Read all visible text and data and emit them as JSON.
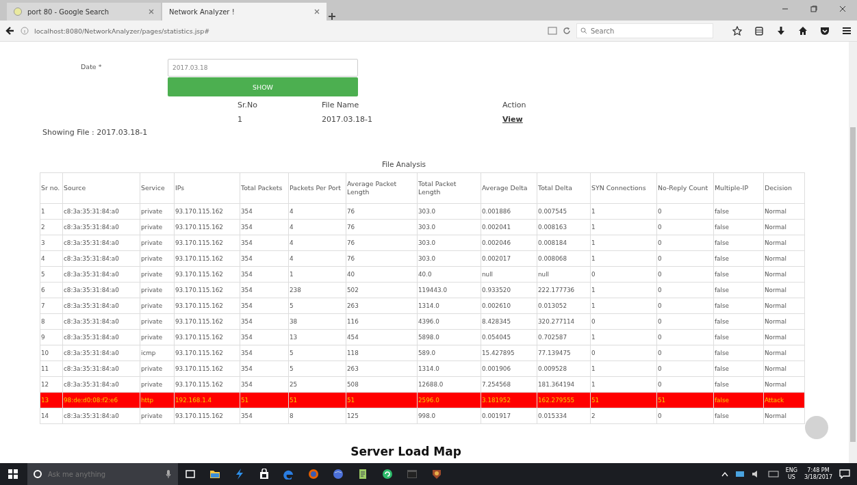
{
  "browser": {
    "tabs": [
      {
        "label": "port 80 - Google Search",
        "selected": false
      },
      {
        "label": "Network Analyzer !",
        "selected": true
      }
    ],
    "address": "localhost:8080/NetworkAnalyzer/pages/statistics.jsp#",
    "search": {
      "placeholder": "Search"
    }
  },
  "form": {
    "date_label": "Date *",
    "date_value": "2017.03.18",
    "button": "SHOW"
  },
  "files": {
    "columns": [
      "Sr.No",
      "File Name",
      "Action"
    ],
    "rows": [
      {
        "sr": "1",
        "name": "2017.03.18-1",
        "action": "View"
      }
    ]
  },
  "showing": "Showing File : 2017.03.18-1",
  "analysis": {
    "title": "File Analysis",
    "columns": [
      "Sr no.",
      "Source",
      "Service",
      "IPs",
      "Total Packets",
      "Packets Per Port",
      "Average Packet Length",
      "Total Packet Length",
      "Average Delta",
      "Total Delta",
      "SYN Connections",
      "No-Reply Count",
      "Multiple-IP",
      "Decision"
    ],
    "rows": [
      {
        "highlighted": false,
        "cells": [
          "1",
          "c8:3a:35:31:84:a0",
          "private",
          "93.170.115.162",
          "354",
          "4",
          "76",
          "303.0",
          "0.001886",
          "0.007545",
          "1",
          "0",
          "false",
          "Normal"
        ]
      },
      {
        "highlighted": false,
        "cells": [
          "2",
          "c8:3a:35:31:84:a0",
          "private",
          "93.170.115.162",
          "354",
          "4",
          "76",
          "303.0",
          "0.002041",
          "0.008163",
          "1",
          "0",
          "false",
          "Normal"
        ]
      },
      {
        "highlighted": false,
        "cells": [
          "3",
          "c8:3a:35:31:84:a0",
          "private",
          "93.170.115.162",
          "354",
          "4",
          "76",
          "303.0",
          "0.002046",
          "0.008184",
          "1",
          "0",
          "false",
          "Normal"
        ]
      },
      {
        "highlighted": false,
        "cells": [
          "4",
          "c8:3a:35:31:84:a0",
          "private",
          "93.170.115.162",
          "354",
          "4",
          "76",
          "303.0",
          "0.002017",
          "0.008068",
          "1",
          "0",
          "false",
          "Normal"
        ]
      },
      {
        "highlighted": false,
        "cells": [
          "5",
          "c8:3a:35:31:84:a0",
          "private",
          "93.170.115.162",
          "354",
          "1",
          "40",
          "40.0",
          "null",
          "null",
          "0",
          "0",
          "false",
          "Normal"
        ]
      },
      {
        "highlighted": false,
        "cells": [
          "6",
          "c8:3a:35:31:84:a0",
          "private",
          "93.170.115.162",
          "354",
          "238",
          "502",
          "119443.0",
          "0.933520",
          "222.177736",
          "1",
          "0",
          "false",
          "Normal"
        ]
      },
      {
        "highlighted": false,
        "cells": [
          "7",
          "c8:3a:35:31:84:a0",
          "private",
          "93.170.115.162",
          "354",
          "5",
          "263",
          "1314.0",
          "0.002610",
          "0.013052",
          "1",
          "0",
          "false",
          "Normal"
        ]
      },
      {
        "highlighted": false,
        "cells": [
          "8",
          "c8:3a:35:31:84:a0",
          "private",
          "93.170.115.162",
          "354",
          "38",
          "116",
          "4396.0",
          "8.428345",
          "320.277114",
          "0",
          "0",
          "false",
          "Normal"
        ]
      },
      {
        "highlighted": false,
        "cells": [
          "9",
          "c8:3a:35:31:84:a0",
          "private",
          "93.170.115.162",
          "354",
          "13",
          "454",
          "5898.0",
          "0.054045",
          "0.702587",
          "1",
          "0",
          "false",
          "Normal"
        ]
      },
      {
        "highlighted": false,
        "cells": [
          "10",
          "c8:3a:35:31:84:a0",
          "icmp",
          "93.170.115.162",
          "354",
          "5",
          "118",
          "589.0",
          "15.427895",
          "77.139475",
          "0",
          "0",
          "false",
          "Normal"
        ]
      },
      {
        "highlighted": false,
        "cells": [
          "11",
          "c8:3a:35:31:84:a0",
          "private",
          "93.170.115.162",
          "354",
          "5",
          "263",
          "1314.0",
          "0.001906",
          "0.009528",
          "1",
          "0",
          "false",
          "Normal"
        ]
      },
      {
        "highlighted": false,
        "cells": [
          "12",
          "c8:3a:35:31:84:a0",
          "private",
          "93.170.115.162",
          "354",
          "25",
          "508",
          "12688.0",
          "7.254568",
          "181.364194",
          "1",
          "0",
          "false",
          "Normal"
        ]
      },
      {
        "highlighted": true,
        "cells": [
          "13",
          "98:de:d0:08:f2:e6",
          "http",
          "192.168.1.4",
          "51",
          "51",
          "51",
          "2596.0",
          "3.181952",
          "162.279555",
          "51",
          "51",
          "false",
          "Attack"
        ]
      },
      {
        "highlighted": false,
        "cells": [
          "14",
          "c8:3a:35:31:84:a0",
          "private",
          "93.170.115.162",
          "354",
          "8",
          "125",
          "998.0",
          "0.001917",
          "0.015334",
          "2",
          "0",
          "false",
          "Normal"
        ]
      }
    ]
  },
  "heading": "Server Load Map",
  "taskbar": {
    "search_placeholder": "Ask me anything",
    "language": "ENG",
    "region": "US",
    "time": "7:48 PM",
    "date": "3/18/2017"
  }
}
